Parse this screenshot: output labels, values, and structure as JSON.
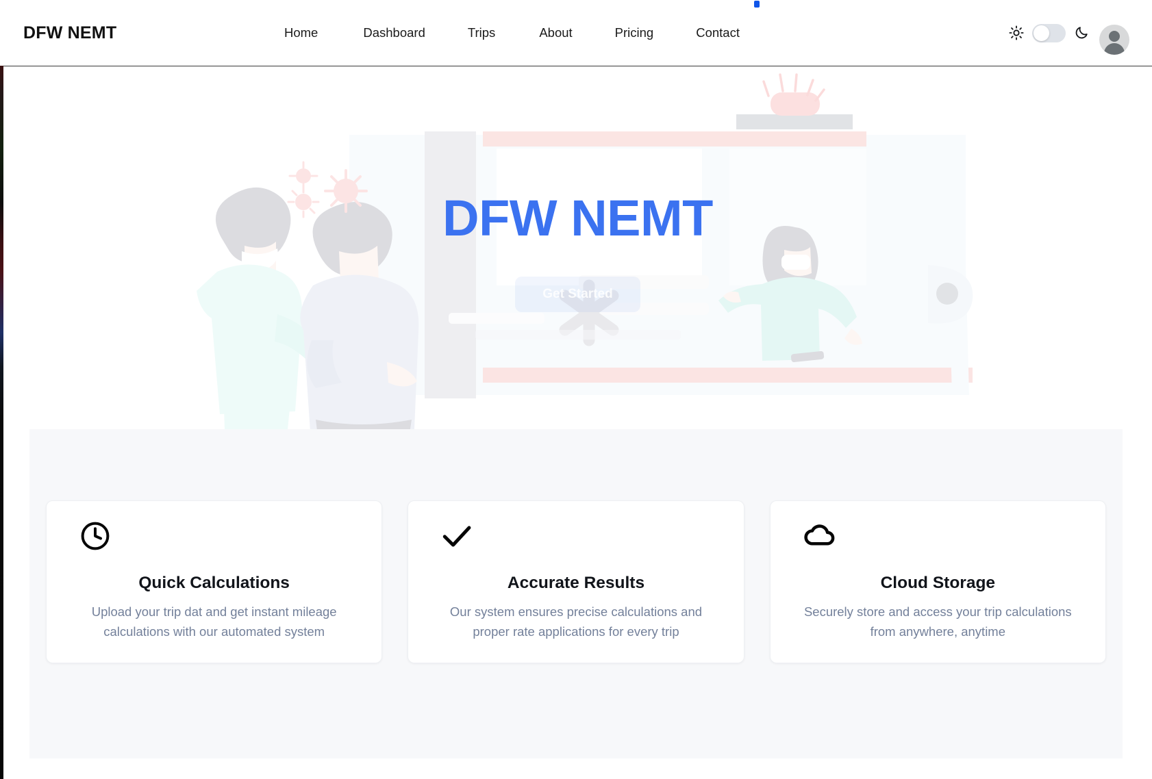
{
  "navbar": {
    "brand": "DFW NEMT",
    "links": [
      {
        "label": "Home"
      },
      {
        "label": "Dashboard"
      },
      {
        "label": "Trips"
      },
      {
        "label": "About"
      },
      {
        "label": "Pricing"
      },
      {
        "label": "Contact"
      }
    ],
    "theme_toggle": {
      "light_icon": "sun-icon",
      "dark_icon": "moon-icon",
      "state": "light"
    },
    "avatar": {
      "icon": "user-avatar-placeholder"
    }
  },
  "hero": {
    "title": "DFW NEMT",
    "cta_label": "Get Started",
    "title_color": "#3b72f0",
    "illustration": "ambulance-paramedic-patient-illustration"
  },
  "features": {
    "cards": [
      {
        "icon": "clock-icon",
        "title": "Quick Calculations",
        "description": "Upload your trip dat and get instant mileage calculations with our automated system"
      },
      {
        "icon": "check-icon",
        "title": "Accurate Results",
        "description": "Our system ensures precise calculations and proper rate applications for every trip"
      },
      {
        "icon": "cloud-icon",
        "title": "Cloud Storage",
        "description": "Securely store and access your trip calculations from anywhere, anytime"
      }
    ],
    "background_color": "#f7f8fa"
  }
}
